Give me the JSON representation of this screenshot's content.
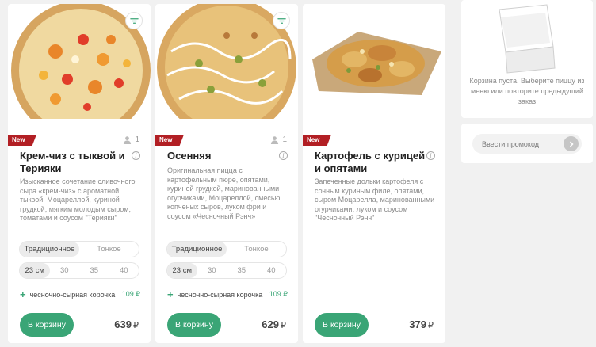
{
  "cards": [
    {
      "badge": "New",
      "persons": "1",
      "title": "Крем-чиз с тыквой и Терияки",
      "description": "Изысканное сочетание сливочного сыра «крем-чиз» с ароматной тыквой, Моцареллой, куриной грудкой, мягким молодым сыром, томатами и соусом \"Терияки\"",
      "dough": [
        "Традиционное",
        "Тонкое"
      ],
      "dough_selected": "Традиционное",
      "sizes": [
        "23 см",
        "30",
        "35",
        "40"
      ],
      "size_selected": "23 см",
      "crust_label": "чесночно-сырная корочка",
      "crust_price": "109 ₽",
      "cart_button": "В корзину",
      "price": "639",
      "currency": "₽"
    },
    {
      "badge": "New",
      "persons": "1",
      "title": "Осенняя",
      "description": "Оригинальная пицца с картофельным пюре, опятами, куриной грудкой, маринованными огурчиками, Моцареллой, смесью копченых сыров, луком фри и соусом «Чесночный Рэнч»",
      "dough": [
        "Традиционное",
        "Тонкое"
      ],
      "dough_selected": "Традиционное",
      "sizes": [
        "23 см",
        "30",
        "35",
        "40"
      ],
      "size_selected": "23 см",
      "crust_label": "чесночно-сырная корочка",
      "crust_price": "109 ₽",
      "cart_button": "В корзину",
      "price": "629",
      "currency": "₽"
    },
    {
      "badge": "New",
      "title": "Картофель с курицей и опятами",
      "description": "Запеченные дольки картофеля с сочным куриным филе, опятами, сыром Моцарелла, маринованными огурчиками, луком и соусом \"Чесночный Рэнч\"",
      "cart_button": "В корзину",
      "price": "379",
      "currency": "₽"
    }
  ],
  "cart": {
    "empty_text": "Корзина пуста. Выберите пиццу из меню или повторите предыдущий заказ"
  },
  "promo": {
    "placeholder": "Ввести промокод"
  },
  "colors": {
    "accent": "#3aa576",
    "badge": "#b21f24"
  }
}
